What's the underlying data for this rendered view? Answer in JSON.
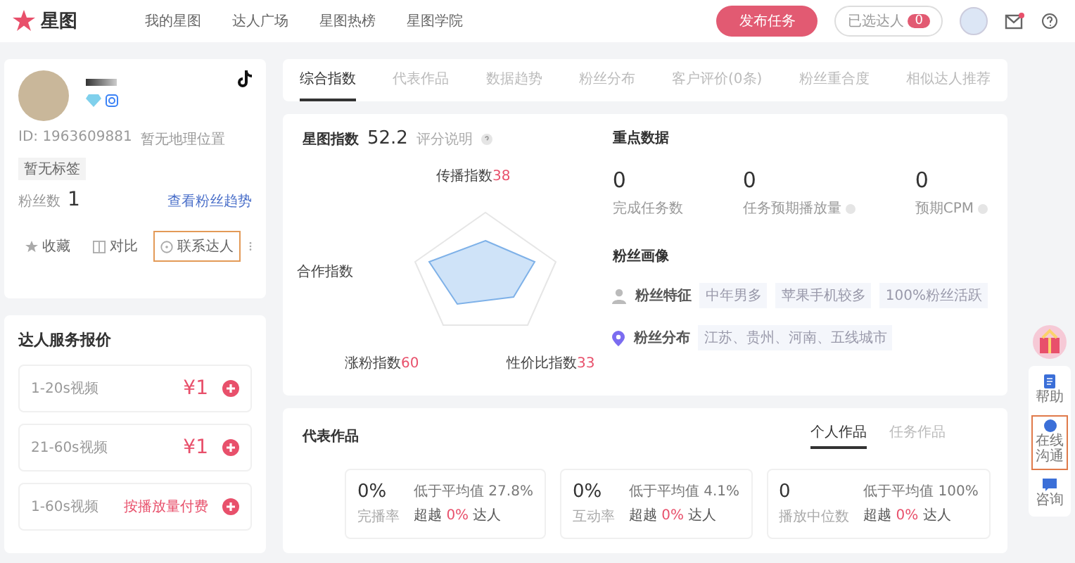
{
  "header": {
    "logo": "星图",
    "nav": [
      "我的星图",
      "达人广场",
      "星图热榜",
      "星图学院"
    ],
    "publish_button": "发布任务",
    "selected_button": {
      "label": "已选达人",
      "count": "0"
    },
    "has_notification": true
  },
  "profile": {
    "id": "ID: 1963609881",
    "location": "暂无地理位置",
    "tag": "暂无标签",
    "fans_label": "粉丝数",
    "fans_value": "1",
    "trend_link": "查看粉丝趋势",
    "actions": [
      {
        "label": "收藏",
        "kind": "star",
        "highlighted": false
      },
      {
        "label": "对比",
        "kind": "compare",
        "highlighted": false
      },
      {
        "label": "联系达人",
        "kind": "contact",
        "highlighted": true
      }
    ]
  },
  "pricing": {
    "title": "达人服务报价",
    "items": [
      {
        "label": "1-20s视频",
        "price": "¥1",
        "kind": "price"
      },
      {
        "label": "21-60s视频",
        "price": "¥1",
        "kind": "price"
      },
      {
        "label": "1-60s视频",
        "price": "按播放量付费",
        "kind": "note"
      }
    ]
  },
  "tabs": [
    {
      "label": "综合指数",
      "selected": true
    },
    {
      "label": "代表作品",
      "selected": false
    },
    {
      "label": "数据趋势",
      "selected": false
    },
    {
      "label": "粉丝分布",
      "selected": false
    },
    {
      "label": "客户评价(0条)",
      "selected": false
    },
    {
      "label": "粉丝重合度",
      "selected": false
    },
    {
      "label": "相似达人推荐",
      "selected": false
    }
  ],
  "index_panel": {
    "title": "星图指数",
    "score": "52.2",
    "help": "评分说明",
    "axes": [
      {
        "label": "传播指数",
        "value": "38"
      },
      {
        "label": "合作指数"
      },
      {
        "label": "涨粉指数",
        "value": "60"
      },
      {
        "label": "性价比指数",
        "value": "33"
      }
    ]
  },
  "key_data": {
    "title": "重点数据",
    "metrics": [
      {
        "value": "0",
        "label": "完成任务数",
        "help": false
      },
      {
        "value": "0",
        "label": "任务预期播放量",
        "help": true
      },
      {
        "value": "0",
        "label": "预期CPM",
        "help": true
      }
    ]
  },
  "fan_profile": {
    "title": "粉丝画像",
    "rows": [
      {
        "kind": "traits",
        "label": "粉丝特征",
        "tags": [
          "中年男多",
          "苹果手机较多",
          "100%粉丝活跃"
        ]
      },
      {
        "kind": "region",
        "label": "粉丝分布",
        "tags": [
          "江苏、贵州、河南、五线城市"
        ]
      }
    ]
  },
  "works": {
    "title": "代表作品",
    "tabs": [
      {
        "label": "个人作品",
        "selected": true
      },
      {
        "label": "任务作品",
        "selected": false
      }
    ],
    "stats": [
      {
        "value": "0%",
        "label": "完播率",
        "compare": "低于平均值 27.8%",
        "beat_prefix": "超越",
        "beat_value": "0%",
        "beat_suffix": "达人"
      },
      {
        "value": "0%",
        "label": "互动率",
        "compare": "低于平均值 4.1%",
        "beat_prefix": "超越",
        "beat_value": "0%",
        "beat_suffix": "达人"
      },
      {
        "value": "0",
        "label": "播放中位数",
        "compare": "低于平均值 100%",
        "beat_prefix": "超越",
        "beat_value": "0%",
        "beat_suffix": "达人"
      }
    ]
  },
  "side_tools": [
    {
      "label": "帮助",
      "kind": "doc",
      "highlighted": false
    },
    {
      "label": "在线沟通",
      "kind": "chat",
      "highlighted": true
    },
    {
      "label": "咨询",
      "kind": "message",
      "highlighted": false
    }
  ]
}
